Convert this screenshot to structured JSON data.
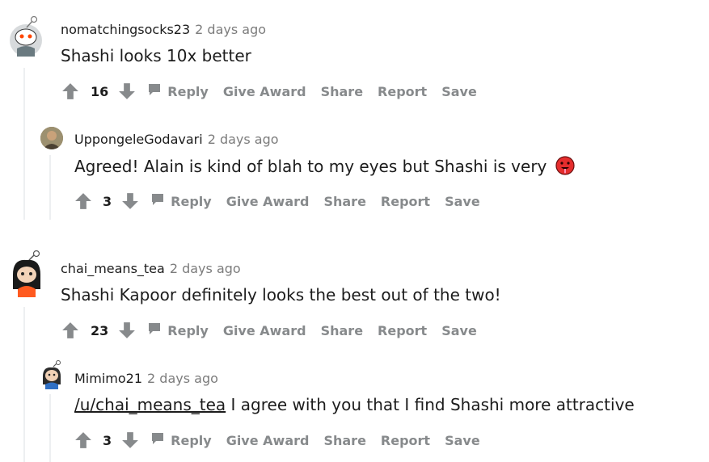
{
  "comments": [
    {
      "username": "nomatchingsocks23",
      "time": "2 days ago",
      "body": "Shashi looks 10x better",
      "score": "16",
      "actions": {
        "reply": "Reply",
        "award": "Give Award",
        "share": "Share",
        "report": "Report",
        "save": "Save"
      },
      "avatar": "snoo-avatar-grey",
      "replies": [
        {
          "username": "UppongeleGodavari",
          "time": "2 days ago",
          "body": "Agreed! Alain is kind of blah to my eyes but Shashi is very",
          "emoji": "drooling-red-face-emoji",
          "score": "3",
          "actions": {
            "reply": "Reply",
            "award": "Give Award",
            "share": "Share",
            "report": "Report",
            "save": "Save"
          },
          "avatar": "photo-avatar"
        }
      ]
    },
    {
      "username": "chai_means_tea",
      "time": "2 days ago",
      "body": "Shashi Kapoor definitely looks the best out of the two!",
      "score": "23",
      "actions": {
        "reply": "Reply",
        "award": "Give Award",
        "share": "Share",
        "report": "Report",
        "save": "Save"
      },
      "avatar": "snoo-avatar-dark-hair",
      "replies": [
        {
          "username": "Mimimo21",
          "time": "2 days ago",
          "mention": "/u/chai_means_tea",
          "body": " I agree with you that I find Shashi more attractive",
          "score": "3",
          "actions": {
            "reply": "Reply",
            "award": "Give Award",
            "share": "Share",
            "report": "Report",
            "save": "Save"
          },
          "avatar": "snoo-avatar-blue"
        }
      ]
    }
  ],
  "colors": {
    "upvote": "#878a8c",
    "thread_line": "#edeff1",
    "meta_gray": "#7c7c7c",
    "text": "#1c1c1c"
  }
}
